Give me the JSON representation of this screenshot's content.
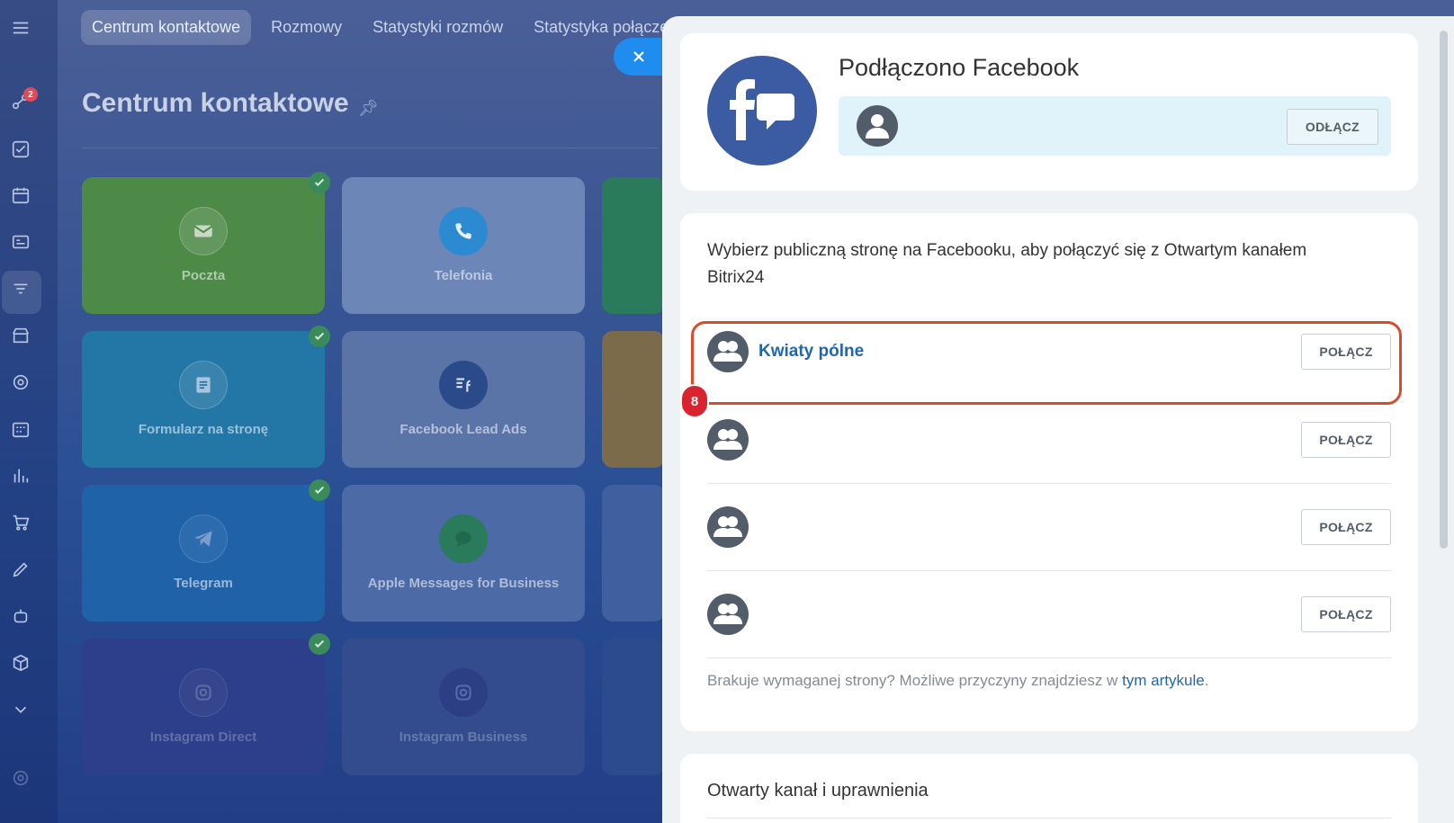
{
  "app": {
    "tabs": [
      {
        "label": "Centrum kontaktowe",
        "active": true
      },
      {
        "label": "Rozmowy"
      },
      {
        "label": "Statystyki rozmów"
      },
      {
        "label": "Statystyka połączeń"
      }
    ],
    "page_title": "Centrum kontaktowe",
    "notification_count": "2",
    "tiles": [
      {
        "label": "Poczta",
        "icon": "mail-icon",
        "checked": true
      },
      {
        "label": "Telefonia",
        "icon": "phone-icon",
        "checked": false
      },
      {
        "label": "Formularz na stronę",
        "icon": "form-icon",
        "checked": true
      },
      {
        "label": "Facebook Lead Ads",
        "icon": "facebook-lead-ads-icon",
        "checked": false
      },
      {
        "label": "Telegram",
        "icon": "telegram-icon",
        "checked": true
      },
      {
        "label": "Apple Messages for Business",
        "icon": "apple-messages-icon",
        "checked": false
      },
      {
        "label": "Instagram Direct",
        "icon": "instagram-direct-icon",
        "checked": true
      },
      {
        "label": "Instagram Business",
        "icon": "instagram-business-icon",
        "checked": false
      }
    ]
  },
  "panel": {
    "connected_title": "Podłączono Facebook",
    "disconnect_label": "ODŁĄCZ",
    "description": "Wybierz publiczną stronę na Facebooku, aby połączyć się z Otwartym kanałem Bitrix24",
    "pages": [
      {
        "name": "Kwiaty pólne",
        "button": "POŁĄCZ"
      },
      {
        "name": "",
        "button": "POŁĄCZ"
      },
      {
        "name": "",
        "button": "POŁĄCZ"
      },
      {
        "name": "",
        "button": "POŁĄCZ"
      }
    ],
    "step_number": "8",
    "footnote_text": "Brakuje wymaganej strony? Możliwe przyczyny znajdziesz w ",
    "footnote_link": "tym artykule",
    "footnote_end": ".",
    "section_title": "Otwarty kanał i uprawnienia"
  },
  "colors": {
    "accent": "#2067b0",
    "facebook": "#3b5ba3",
    "highlight": "#dc4a2a",
    "badge": "#d9232e"
  }
}
